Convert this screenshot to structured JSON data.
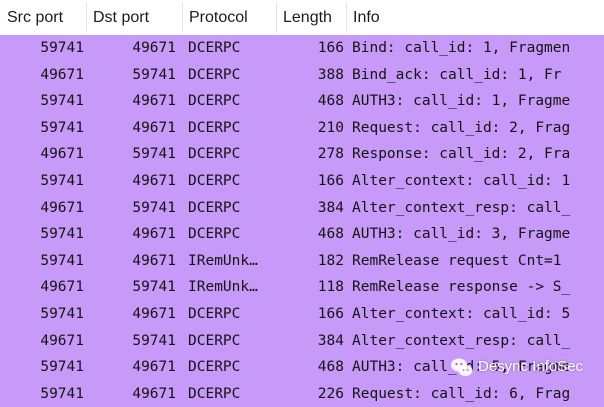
{
  "columns": [
    "Src port",
    "Dst port",
    "Protocol",
    "Length",
    "Info"
  ],
  "rows": [
    {
      "src": "59741",
      "dst": "49671",
      "protocol": "DCERPC",
      "length": "166",
      "info": "Bind: call_id: 1, Fragmen"
    },
    {
      "src": "49671",
      "dst": "59741",
      "protocol": "DCERPC",
      "length": "388",
      "info": "Bind_ack: call_id: 1, Fr"
    },
    {
      "src": "59741",
      "dst": "49671",
      "protocol": "DCERPC",
      "length": "468",
      "info": "AUTH3: call_id: 1, Fragme"
    },
    {
      "src": "59741",
      "dst": "49671",
      "protocol": "DCERPC",
      "length": "210",
      "info": "Request: call_id: 2, Frag"
    },
    {
      "src": "49671",
      "dst": "59741",
      "protocol": "DCERPC",
      "length": "278",
      "info": "Response: call_id: 2, Fra"
    },
    {
      "src": "59741",
      "dst": "49671",
      "protocol": "DCERPC",
      "length": "166",
      "info": "Alter_context: call_id: 1"
    },
    {
      "src": "49671",
      "dst": "59741",
      "protocol": "DCERPC",
      "length": "384",
      "info": "Alter_context_resp: call_"
    },
    {
      "src": "59741",
      "dst": "49671",
      "protocol": "DCERPC",
      "length": "468",
      "info": "AUTH3: call_id: 3, Fragme"
    },
    {
      "src": "59741",
      "dst": "49671",
      "protocol": "IRemUnk…",
      "length": "182",
      "info": "RemRelease request Cnt=1"
    },
    {
      "src": "49671",
      "dst": "59741",
      "protocol": "IRemUnk…",
      "length": "118",
      "info": "RemRelease response -> S_"
    },
    {
      "src": "59741",
      "dst": "49671",
      "protocol": "DCERPC",
      "length": "166",
      "info": "Alter_context: call_id: 5"
    },
    {
      "src": "49671",
      "dst": "59741",
      "protocol": "DCERPC",
      "length": "384",
      "info": "Alter_context_resp: call_"
    },
    {
      "src": "59741",
      "dst": "49671",
      "protocol": "DCERPC",
      "length": "468",
      "info": "AUTH3: call_id: 5, Fragme"
    },
    {
      "src": "59741",
      "dst": "49671",
      "protocol": "DCERPC",
      "length": "226",
      "info": "Request: call_id: 6, Frag"
    }
  ],
  "watermark": {
    "text": "Desync InfoSec",
    "icon": "wechat-icon"
  },
  "colors": {
    "row_highlight": "#c799f8",
    "header_bg": "#ffffff"
  }
}
